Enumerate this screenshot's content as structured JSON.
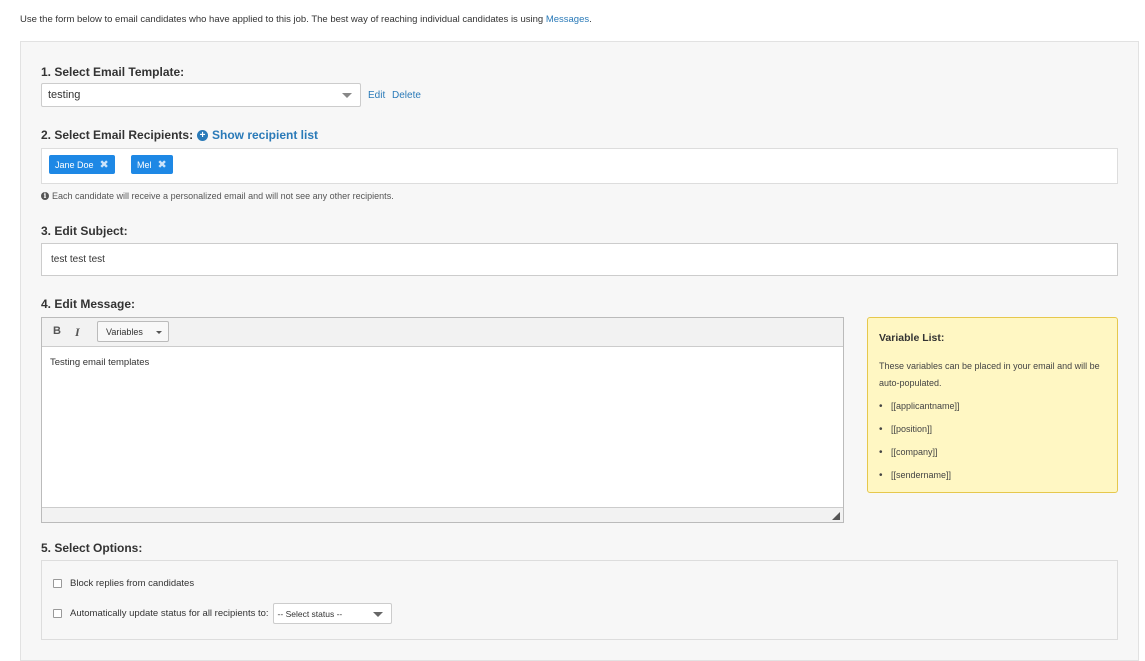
{
  "intro": {
    "text": "Use the form below to email candidates who have applied to this job. The best way of reaching individual candidates is using ",
    "link": "Messages",
    "suffix": "."
  },
  "template_section": {
    "label": "1. Select Email Template:",
    "selected": "testing",
    "edit_label": "Edit",
    "delete_label": "Delete"
  },
  "recipients_section": {
    "label": "2. Select Email Recipients:",
    "show_list_label": "Show recipient list",
    "recipients": [
      {
        "name": "Jane Doe"
      },
      {
        "name": "Mel"
      }
    ],
    "remove_glyph": "✖",
    "hint": "Each candidate will receive a personalized email and will not see any other recipients."
  },
  "subject_section": {
    "label": "3. Edit Subject:",
    "value": "test test test"
  },
  "message_section": {
    "label": "4. Edit Message:",
    "bold_label": "B",
    "italic_label": "I",
    "variables_label": "Variables",
    "body": "Testing email templates"
  },
  "variable_list": {
    "title": "Variable List:",
    "description": "These variables can be placed in your email and will be auto-populated.",
    "items": [
      "[[applicantname]]",
      "[[position]]",
      "[[company]]",
      "[[sendername]]"
    ]
  },
  "options_section": {
    "label": "5. Select Options:",
    "block_replies_label": "Block replies from candidates",
    "block_replies_checked": false,
    "auto_update_label": "Automatically update status for all recipients to:",
    "auto_update_checked": false,
    "status_select_value": "-- Select status --"
  }
}
